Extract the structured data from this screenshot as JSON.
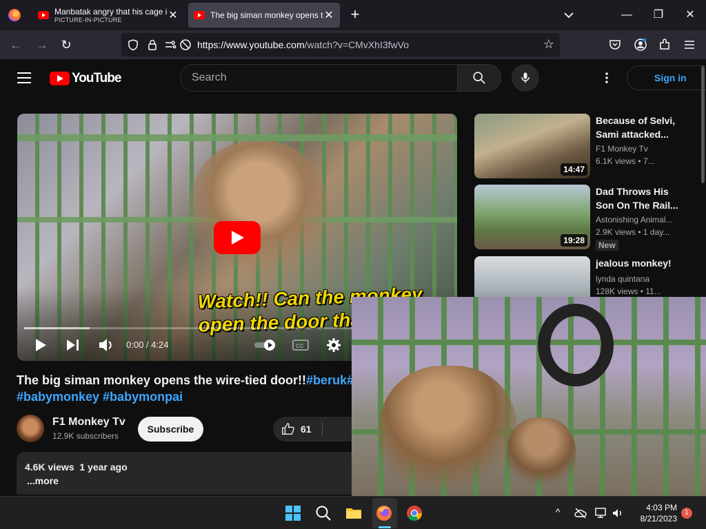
{
  "browser": {
    "tabs": [
      {
        "title": "Manbatak angry that his cage i",
        "subtitle": "PICTURE-IN-PICTURE",
        "active": false
      },
      {
        "title": "The big siman monkey opens th",
        "active": true
      }
    ],
    "url_domain": "https://www.youtube.com",
    "url_path": "/watch?v=CMvXhI3fwVo"
  },
  "youtube": {
    "logo_text": "YouTube",
    "search_placeholder": "Search",
    "signin_label": "Sign in",
    "player": {
      "caption": "Watch!! Can the monkey open the door that is tied?",
      "time": "0:00 / 4:24",
      "progress_fraction": 0.0
    },
    "video": {
      "title": "The big siman monkey opens the wire-tied door!!",
      "title_tag": "#beruk",
      "title_tag2": "#",
      "tags_line": "#babymonkey #babymonpai",
      "channel_name": "F1 Monkey Tv",
      "subscribers": "12.9K subscribers",
      "subscribe_label": "Subscribe",
      "likes": "61",
      "views_meta": "4.6K views  1 year ago",
      "more_label": "...more"
    },
    "recommendations": [
      {
        "title": "Because of Selvi, Sami attacked...",
        "channel": "F1 Monkey Tv",
        "views": "6.1K views  •  7...",
        "duration": "14:47"
      },
      {
        "title": "Dad Throws His Son On The Rail...",
        "channel": "Astonishing Animal...",
        "views": "2.9K views  •  1 day...",
        "duration": "19:28",
        "badge": "New"
      },
      {
        "title": "jealous monkey!",
        "channel": "lynda quintana",
        "views": "128K views  •  11..."
      }
    ]
  },
  "taskbar": {
    "time": "4:03 PM",
    "date": "8/21/2023",
    "notification_count": "1"
  },
  "colors": {
    "yt_red": "#ff0000",
    "link_blue": "#3ea6ff",
    "firefox_active_tab": "#42414d"
  }
}
